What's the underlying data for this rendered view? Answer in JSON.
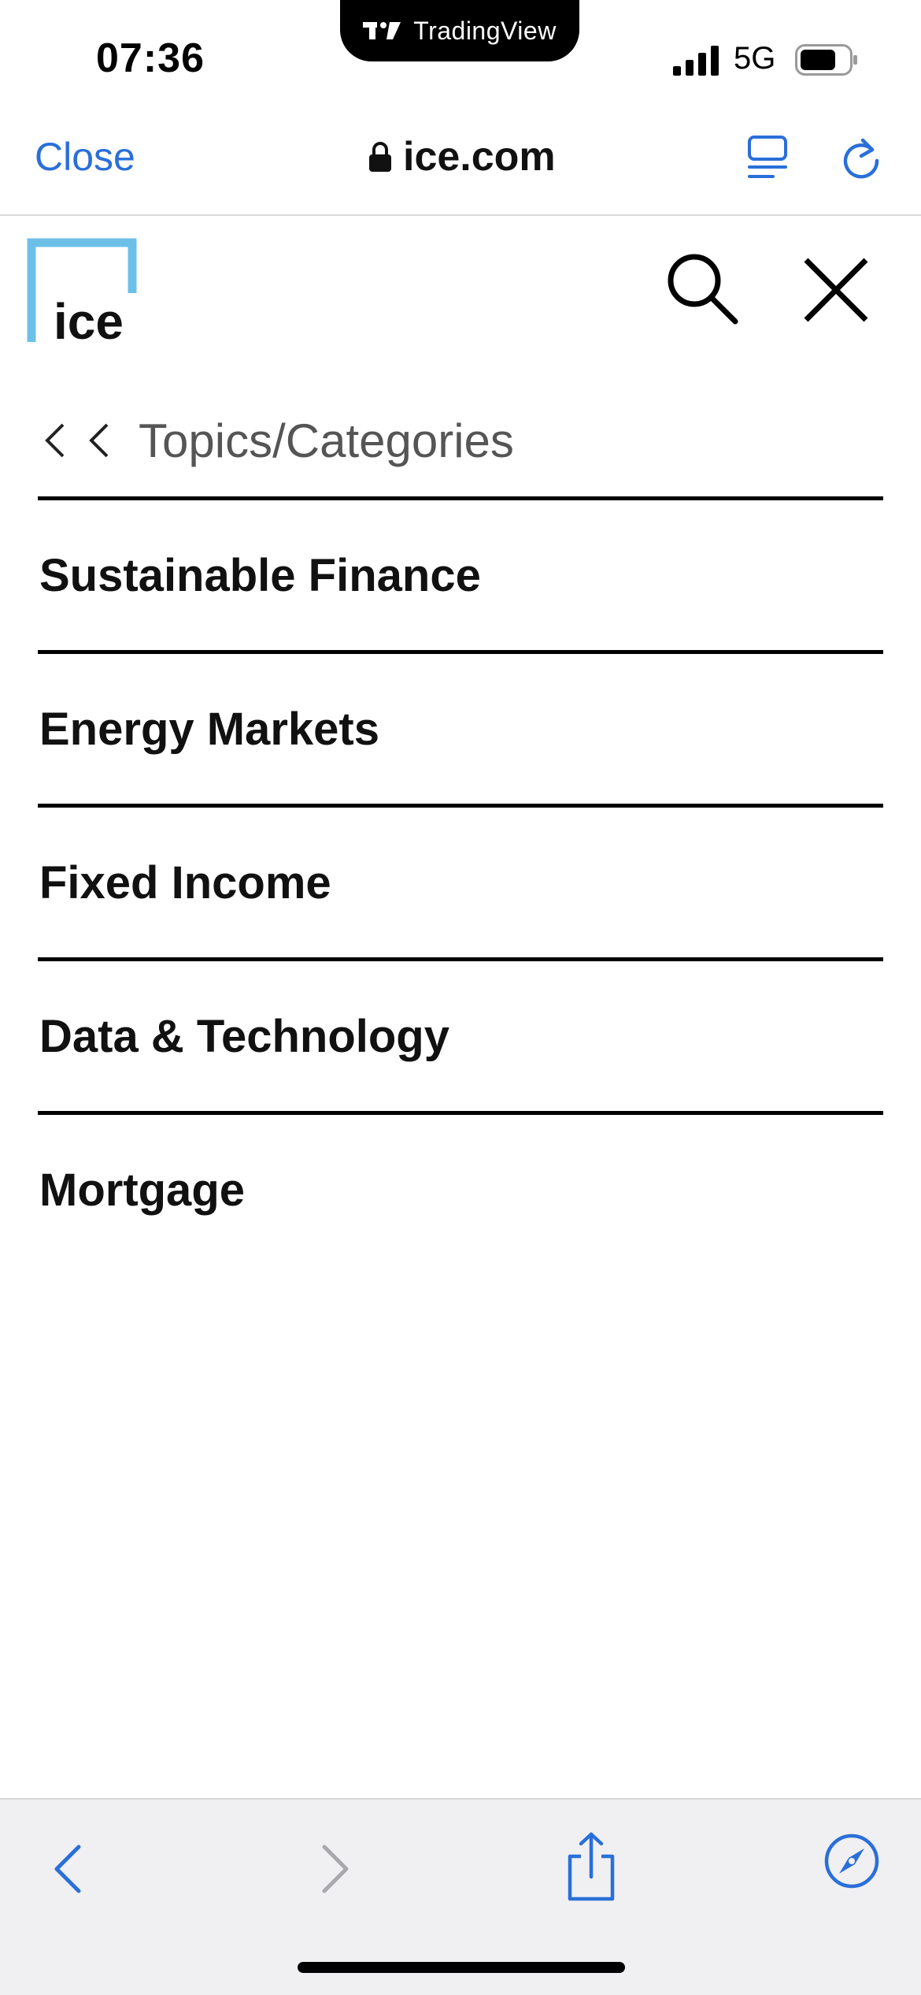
{
  "status_bar": {
    "time": "07:36",
    "island_app": "TradingView",
    "network": "5G",
    "icons": [
      "tradingview-logo-icon",
      "signal-icon",
      "battery-icon"
    ]
  },
  "browser": {
    "close_label": "Close",
    "url": "ice.com",
    "accent_color": "#2a6fd9",
    "icons": [
      "lock-icon",
      "reader-view-icon",
      "reload-icon"
    ]
  },
  "site": {
    "logo_text": "ice",
    "logo_color": "#6cc0e8",
    "icons": [
      "search-icon",
      "close-menu-icon"
    ]
  },
  "breadcrumb": {
    "label": "Topics/Categories"
  },
  "menu": {
    "items": [
      {
        "label": "Sustainable Finance"
      },
      {
        "label": "Energy Markets"
      },
      {
        "label": "Fixed Income"
      },
      {
        "label": "Data & Technology"
      },
      {
        "label": "Mortgage"
      }
    ]
  },
  "toolbar": {
    "icons": [
      "back-icon",
      "forward-icon",
      "share-icon",
      "safari-icon"
    ]
  }
}
